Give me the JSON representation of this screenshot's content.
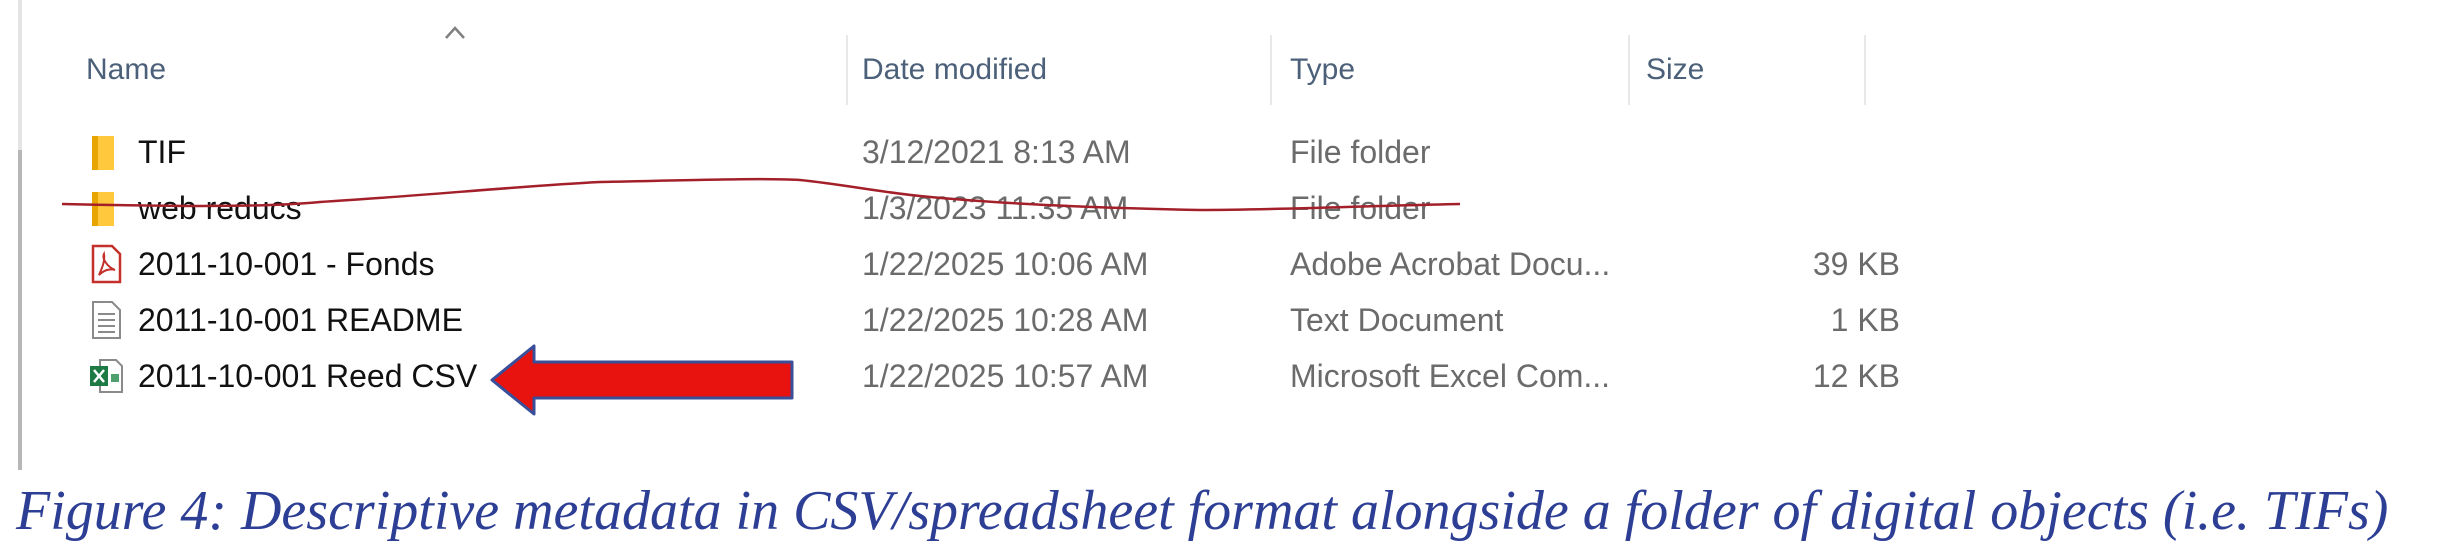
{
  "columns": {
    "name": "Name",
    "date_modified": "Date modified",
    "type": "Type",
    "size": "Size"
  },
  "files": [
    {
      "name": "TIF",
      "date": "3/12/2021 8:13 AM",
      "type": "File folder",
      "size": "",
      "icon": "folder-icon"
    },
    {
      "name": "web reducs",
      "date": "1/3/2023 11:35 AM",
      "type": "File folder",
      "size": "",
      "icon": "folder-icon",
      "struck_through": true
    },
    {
      "name": "2011-10-001 - Fonds",
      "date": "1/22/2025 10:06 AM",
      "type": "Adobe Acrobat Docu...",
      "size": "39 KB",
      "icon": "pdf-icon"
    },
    {
      "name": "2011-10-001 README",
      "date": "1/22/2025 10:28 AM",
      "type": "Text Document",
      "size": "1 KB",
      "icon": "text-document-icon"
    },
    {
      "name": "2011-10-001 Reed CSV",
      "date": "1/22/2025 10:57 AM",
      "type": "Microsoft Excel Com...",
      "size": "12 KB",
      "icon": "excel-csv-icon"
    }
  ],
  "annotations": {
    "arrow_color": "#e8120f",
    "strike_color": "#a3202a"
  },
  "caption": "Figure 4: Descriptive metadata in CSV/spreadsheet format alongside a folder of digital objects (i.e. TIFs)"
}
